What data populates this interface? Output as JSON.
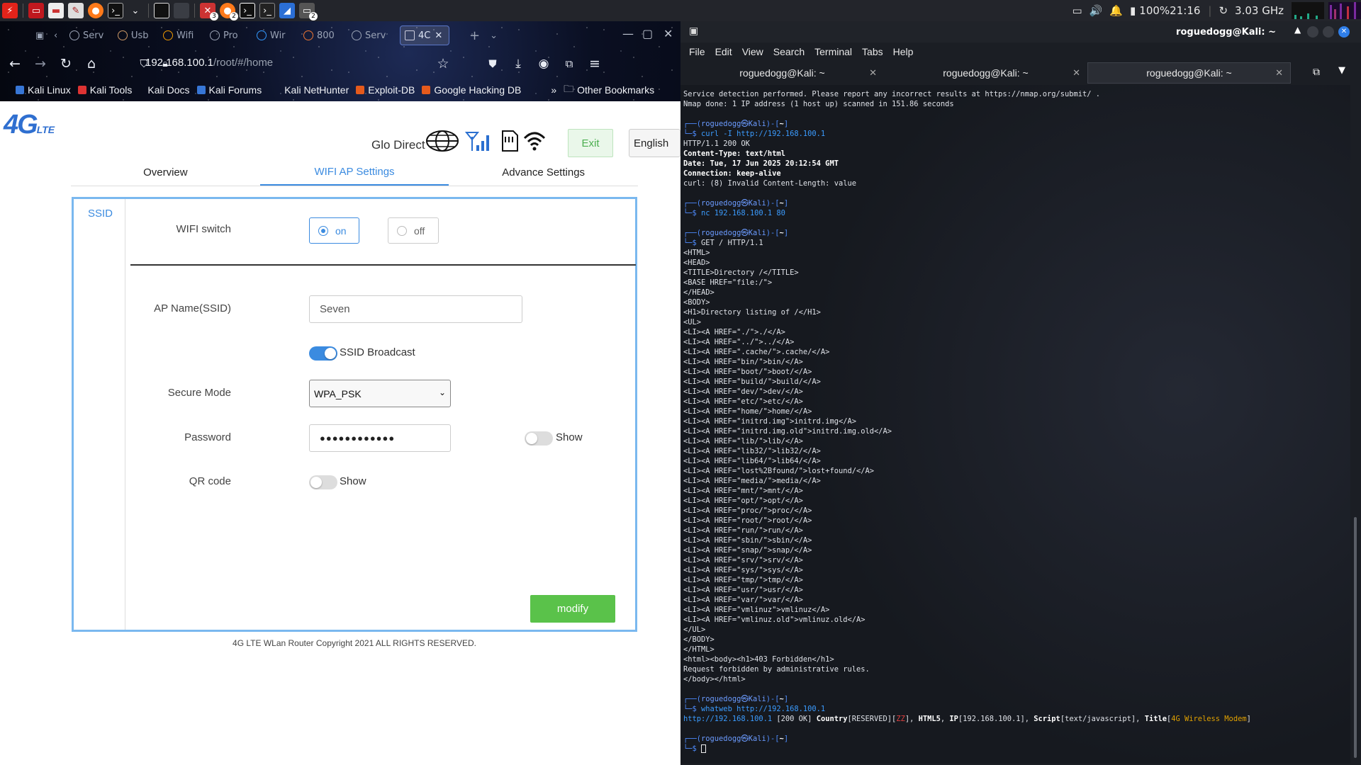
{
  "panel": {
    "battery": "100%",
    "clock": "21:16",
    "cpu": "3.03 GHz",
    "badge_one": "3",
    "badge_two": "2",
    "badge_three": "2"
  },
  "browser": {
    "tabs": [
      "Serv",
      "Usb",
      "Wifi",
      "Pro",
      "Wir",
      "800",
      "Serv",
      "4C"
    ],
    "url_main": "192.168.100.1",
    "url_rest": "/root/#/home",
    "bookmarks": [
      "Kali Linux",
      "Kali Tools",
      "Kali Docs",
      "Kali Forums",
      "Kali NetHunter",
      "Exploit-DB",
      "Google Hacking DB"
    ],
    "other_bookmarks": "Other Bookmarks"
  },
  "router": {
    "logo": "4G",
    "logo_sub": "LTE",
    "operator": "Glo Direct",
    "exit_label": "Exit",
    "language": "English",
    "tabs": [
      "Overview",
      "WIFI AP Settings",
      "Advance Settings"
    ],
    "side_ssid": "SSID",
    "wifi_switch_label": "WIFI switch",
    "wifi_on": "on",
    "wifi_off": "off",
    "ap_name_label": "AP Name(SSID)",
    "ap_name_value": "Seven",
    "ssid_broadcast_label": "SSID Broadcast",
    "secure_mode_label": "Secure Mode",
    "secure_mode_value": "WPA_PSK",
    "password_label": "Password",
    "password_value": "●●●●●●●●●●●●",
    "password_show": "Show",
    "qr_label": "QR code",
    "qr_show": "Show",
    "modify_label": "modify",
    "copyright": "4G LTE WLan Router Copyright 2021 ALL RIGHTS RESERVED."
  },
  "terminal": {
    "title": "roguedogg@Kali: ~",
    "menu": [
      "File",
      "Edit",
      "View",
      "Search",
      "Terminal",
      "Tabs",
      "Help"
    ],
    "tabs": [
      "roguedogg@Kali: ~",
      "roguedogg@Kali: ~",
      "roguedogg@Kali: ~"
    ],
    "pre_lines": [
      "Service detection performed. Please report any incorrect results at https://nmap.org/submit/ .",
      "Nmap done: 1 IP address (1 host up) scanned in 151.86 seconds"
    ],
    "cmd_curl": "curl -I http://192.168.100.1",
    "curl_out": [
      "HTTP/1.1 200 OK",
      "Content-Type: text/html",
      "Date: Tue, 17 Jun 2025 20:12:54 GMT",
      "Connection: keep-alive",
      "curl: (8) Invalid Content-Length: value"
    ],
    "cmd_nc": "nc 192.168.100.1 80",
    "cmd_get": "GET / HTTP/1.1",
    "listing": [
      "<HTML>",
      "<HEAD>",
      "<TITLE>Directory /</TITLE>",
      "<BASE HREF=\"file:/\">",
      "</HEAD>",
      "<BODY>",
      "<H1>Directory listing of /</H1>",
      "<UL>",
      "<LI><A HREF=\"./\">./</A>",
      "<LI><A HREF=\"../\">../</A>",
      "<LI><A HREF=\".cache/\">.cache/</A>",
      "<LI><A HREF=\"bin/\">bin/</A>",
      "<LI><A HREF=\"boot/\">boot/</A>",
      "<LI><A HREF=\"build/\">build/</A>",
      "<LI><A HREF=\"dev/\">dev/</A>",
      "<LI><A HREF=\"etc/\">etc/</A>",
      "<LI><A HREF=\"home/\">home/</A>",
      "<LI><A HREF=\"initrd.img\">initrd.img</A>",
      "<LI><A HREF=\"initrd.img.old\">initrd.img.old</A>",
      "<LI><A HREF=\"lib/\">lib/</A>",
      "<LI><A HREF=\"lib32/\">lib32/</A>",
      "<LI><A HREF=\"lib64/\">lib64/</A>",
      "<LI><A HREF=\"lost%2Bfound/\">lost+found/</A>",
      "<LI><A HREF=\"media/\">media/</A>",
      "<LI><A HREF=\"mnt/\">mnt/</A>",
      "<LI><A HREF=\"opt/\">opt/</A>",
      "<LI><A HREF=\"proc/\">proc/</A>",
      "<LI><A HREF=\"root/\">root/</A>",
      "<LI><A HREF=\"run/\">run/</A>",
      "<LI><A HREF=\"sbin/\">sbin/</A>",
      "<LI><A HREF=\"snap/\">snap/</A>",
      "<LI><A HREF=\"srv/\">srv/</A>",
      "<LI><A HREF=\"sys/\">sys/</A>",
      "<LI><A HREF=\"tmp/\">tmp/</A>",
      "<LI><A HREF=\"usr/\">usr/</A>",
      "<LI><A HREF=\"var/\">var/</A>",
      "<LI><A HREF=\"vmlinuz\">vmlinuz</A>",
      "<LI><A HREF=\"vmlinuz.old\">vmlinuz.old</A>",
      "</UL>",
      "</BODY>",
      "</HTML>",
      "<html><body><h1>403 Forbidden</h1>",
      "Request forbidden by administrative rules.",
      "</body></html>"
    ],
    "cmd_whatweb": "whatweb http://192.168.100.1",
    "whatweb_url": "http://192.168.100.1",
    "whatweb_status": " [200 OK] ",
    "whatweb_k1": "Country",
    "whatweb_v1": "[RESERVED][",
    "whatweb_zz": "ZZ",
    "whatweb_v1b": "], ",
    "whatweb_k2": "HTML5",
    "whatweb_sep2": ", ",
    "whatweb_k3": "IP",
    "whatweb_v3": "[192.168.100.1], ",
    "whatweb_k4": "Script",
    "whatweb_v4": "[text/javascript], ",
    "whatweb_k5": "Title",
    "whatweb_v5a": "[",
    "whatweb_title": "4G Wireless Modem",
    "whatweb_v5b": "]",
    "prompt_user": "roguedogg",
    "prompt_at": "㉿",
    "prompt_host": "Kali",
    "prompt_path": "~"
  }
}
